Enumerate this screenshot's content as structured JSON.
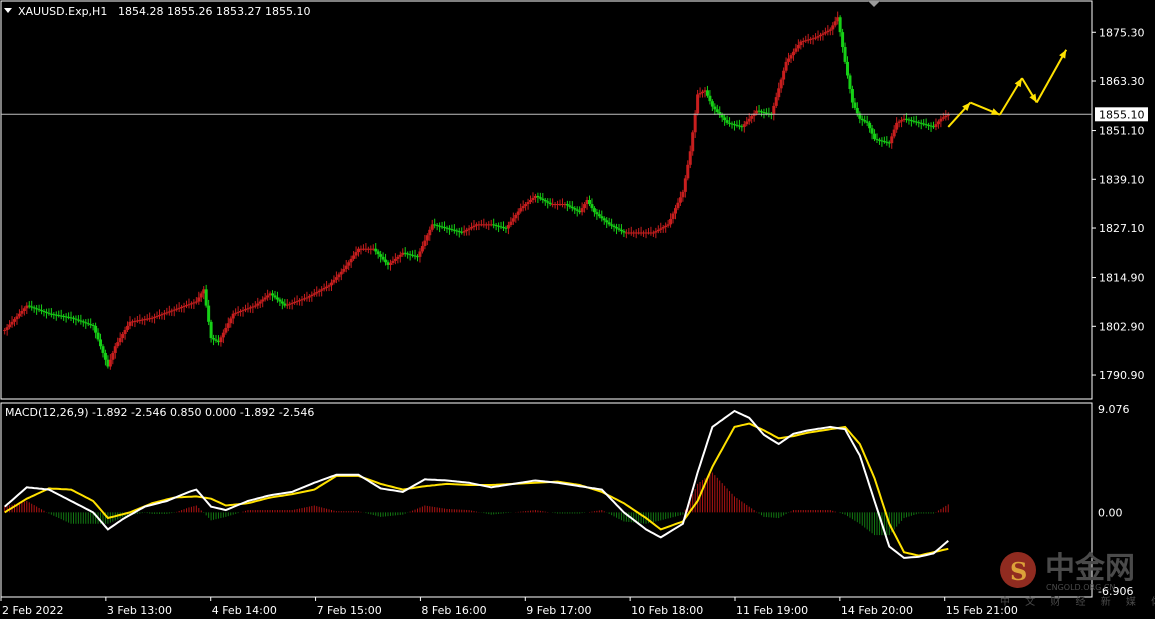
{
  "header": {
    "menu_arrow": "triangle-down-icon",
    "symbol": "XAUUSD.Exp,H1",
    "ohlc": "1854.28 1855.26 1853.27 1855.10"
  },
  "macd_header": "MACD(12,26,9) -1.892 -2.546 0.850 0.000 -1.892 -2.546",
  "watermark": {
    "main": "中金网",
    "sub": "CNGOLD.ORG.CN",
    "cn": "中 文 财 经 新 媒 体"
  },
  "colors": {
    "background": "#000000",
    "bull": "#c81e1e",
    "bear": "#16d016",
    "grid_border": "#ffffff",
    "macd_line": "#ffffff",
    "signal_line": "#ffe100",
    "hist_pos": "#b01414",
    "hist_neg": "#127812",
    "arrows": "#ffe100",
    "watermark_logo": "#c0392b"
  },
  "chart_data": [
    {
      "type": "candlestick",
      "title": "XAUUSD.Exp,H1",
      "timeframe": "H1",
      "ylim": [
        1785.0,
        1883.0
      ],
      "y_ticks": [
        "1875.30",
        "1863.30",
        "1851.10",
        "1839.10",
        "1827.10",
        "1814.90",
        "1802.90",
        "1790.90"
      ],
      "current_price": "1855.10",
      "x_labels": [
        "2 Feb 2022",
        "3 Feb 13:00",
        "4 Feb 14:00",
        "7 Feb 15:00",
        "8 Feb 16:00",
        "9 Feb 17:00",
        "10 Feb 18:00",
        "11 Feb 19:00",
        "14 Feb 20:00",
        "15 Feb 21:00"
      ],
      "close_path": [
        [
          0,
          1802
        ],
        [
          3,
          1808
        ],
        [
          6,
          1806
        ],
        [
          9,
          1805
        ],
        [
          12,
          1803
        ],
        [
          14,
          1793
        ],
        [
          15,
          1798
        ],
        [
          17,
          1804
        ],
        [
          20,
          1805
        ],
        [
          23,
          1807
        ],
        [
          26,
          1809
        ],
        [
          27,
          1812
        ],
        [
          28,
          1800
        ],
        [
          29,
          1799
        ],
        [
          31,
          1806
        ],
        [
          34,
          1808
        ],
        [
          36,
          1811
        ],
        [
          38,
          1808
        ],
        [
          41,
          1810
        ],
        [
          44,
          1813
        ],
        [
          46,
          1817
        ],
        [
          48,
          1822
        ],
        [
          50,
          1822
        ],
        [
          52,
          1818
        ],
        [
          54,
          1821
        ],
        [
          56,
          1820
        ],
        [
          58,
          1828
        ],
        [
          60,
          1827
        ],
        [
          62,
          1826
        ],
        [
          64,
          1828
        ],
        [
          66,
          1828
        ],
        [
          68,
          1827
        ],
        [
          70,
          1832
        ],
        [
          72,
          1835
        ],
        [
          74,
          1833
        ],
        [
          76,
          1833
        ],
        [
          78,
          1831
        ],
        [
          79,
          1834
        ],
        [
          80,
          1831
        ],
        [
          82,
          1828
        ],
        [
          84,
          1826
        ],
        [
          86,
          1826
        ],
        [
          88,
          1826
        ],
        [
          90,
          1828
        ],
        [
          92,
          1836
        ],
        [
          93,
          1846
        ],
        [
          94,
          1860
        ],
        [
          95,
          1861
        ],
        [
          96,
          1857
        ],
        [
          98,
          1853
        ],
        [
          100,
          1852
        ],
        [
          102,
          1856
        ],
        [
          104,
          1855
        ],
        [
          106,
          1868
        ],
        [
          108,
          1873
        ],
        [
          110,
          1874
        ],
        [
          112,
          1876
        ],
        [
          113,
          1879
        ],
        [
          114,
          1868
        ],
        [
          115,
          1858
        ],
        [
          116,
          1854
        ],
        [
          117,
          1853
        ],
        [
          118,
          1849
        ],
        [
          120,
          1848
        ],
        [
          121,
          1853
        ],
        [
          122,
          1854
        ],
        [
          124,
          1853
        ],
        [
          126,
          1852
        ],
        [
          127,
          1854
        ],
        [
          128,
          1855.1
        ]
      ],
      "projection_arrows": [
        [
          [
            128,
            1852
          ],
          [
            131,
            1858
          ]
        ],
        [
          [
            131,
            1858
          ],
          [
            135,
            1855
          ]
        ],
        [
          [
            135,
            1855
          ],
          [
            138,
            1864
          ]
        ],
        [
          [
            138,
            1864
          ],
          [
            140,
            1858
          ]
        ],
        [
          [
            140,
            1858
          ],
          [
            144,
            1871
          ]
        ]
      ]
    },
    {
      "type": "macd",
      "title": "MACD(12,26,9)",
      "params": [
        12,
        26,
        9
      ],
      "values": {
        "macd": -1.892,
        "signal": -2.546,
        "histogram": 0.85,
        "zero": 0.0
      },
      "ylim": [
        -6.906,
        9.076
      ],
      "y_ticks": [
        "9.076",
        "0.00",
        "-6.906"
      ],
      "macd_path": [
        [
          0,
          0.5
        ],
        [
          3,
          2.2
        ],
        [
          6,
          2.0
        ],
        [
          9,
          1.0
        ],
        [
          12,
          0.0
        ],
        [
          14,
          -1.5
        ],
        [
          16,
          -0.6
        ],
        [
          19,
          0.5
        ],
        [
          22,
          1.0
        ],
        [
          25,
          1.8
        ],
        [
          26,
          2.0
        ],
        [
          28,
          0.5
        ],
        [
          30,
          0.2
        ],
        [
          33,
          1.0
        ],
        [
          36,
          1.5
        ],
        [
          39,
          1.8
        ],
        [
          42,
          2.6
        ],
        [
          45,
          3.3
        ],
        [
          48,
          3.3
        ],
        [
          51,
          2.1
        ],
        [
          54,
          1.8
        ],
        [
          57,
          2.9
        ],
        [
          60,
          2.8
        ],
        [
          63,
          2.6
        ],
        [
          66,
          2.2
        ],
        [
          69,
          2.5
        ],
        [
          72,
          2.8
        ],
        [
          75,
          2.6
        ],
        [
          78,
          2.3
        ],
        [
          81,
          2.0
        ],
        [
          84,
          0.0
        ],
        [
          87,
          -1.5
        ],
        [
          89,
          -2.2
        ],
        [
          92,
          -1.0
        ],
        [
          94,
          3.5
        ],
        [
          96,
          7.5
        ],
        [
          99,
          8.9
        ],
        [
          101,
          8.3
        ],
        [
          103,
          6.8
        ],
        [
          105,
          6.0
        ],
        [
          107,
          6.9
        ],
        [
          109,
          7.2
        ],
        [
          112,
          7.5
        ],
        [
          114,
          7.3
        ],
        [
          116,
          5.0
        ],
        [
          118,
          1.0
        ],
        [
          120,
          -3.0
        ],
        [
          122,
          -4.0
        ],
        [
          124,
          -3.9
        ],
        [
          126,
          -3.6
        ],
        [
          128,
          -2.5
        ]
      ],
      "signal_path": [
        [
          0,
          0.0
        ],
        [
          3,
          1.2
        ],
        [
          6,
          2.1
        ],
        [
          9,
          2.0
        ],
        [
          12,
          1.0
        ],
        [
          14,
          -0.5
        ],
        [
          17,
          0.0
        ],
        [
          20,
          0.8
        ],
        [
          23,
          1.3
        ],
        [
          26,
          1.4
        ],
        [
          28,
          1.2
        ],
        [
          30,
          0.6
        ],
        [
          33,
          0.8
        ],
        [
          36,
          1.3
        ],
        [
          39,
          1.6
        ],
        [
          42,
          2.0
        ],
        [
          45,
          3.2
        ],
        [
          48,
          3.2
        ],
        [
          51,
          2.5
        ],
        [
          54,
          2.0
        ],
        [
          57,
          2.3
        ],
        [
          60,
          2.5
        ],
        [
          63,
          2.4
        ],
        [
          66,
          2.4
        ],
        [
          69,
          2.5
        ],
        [
          72,
          2.6
        ],
        [
          75,
          2.7
        ],
        [
          78,
          2.4
        ],
        [
          81,
          1.8
        ],
        [
          84,
          0.8
        ],
        [
          87,
          -0.5
        ],
        [
          89,
          -1.5
        ],
        [
          92,
          -0.8
        ],
        [
          94,
          1.0
        ],
        [
          96,
          4.0
        ],
        [
          99,
          7.5
        ],
        [
          101,
          7.8
        ],
        [
          103,
          7.2
        ],
        [
          105,
          6.5
        ],
        [
          107,
          6.7
        ],
        [
          109,
          7.0
        ],
        [
          112,
          7.3
        ],
        [
          114,
          7.5
        ],
        [
          116,
          6.0
        ],
        [
          118,
          3.0
        ],
        [
          120,
          -1.0
        ],
        [
          122,
          -3.5
        ],
        [
          124,
          -3.8
        ],
        [
          126,
          -3.5
        ],
        [
          128,
          -3.2
        ]
      ]
    }
  ]
}
